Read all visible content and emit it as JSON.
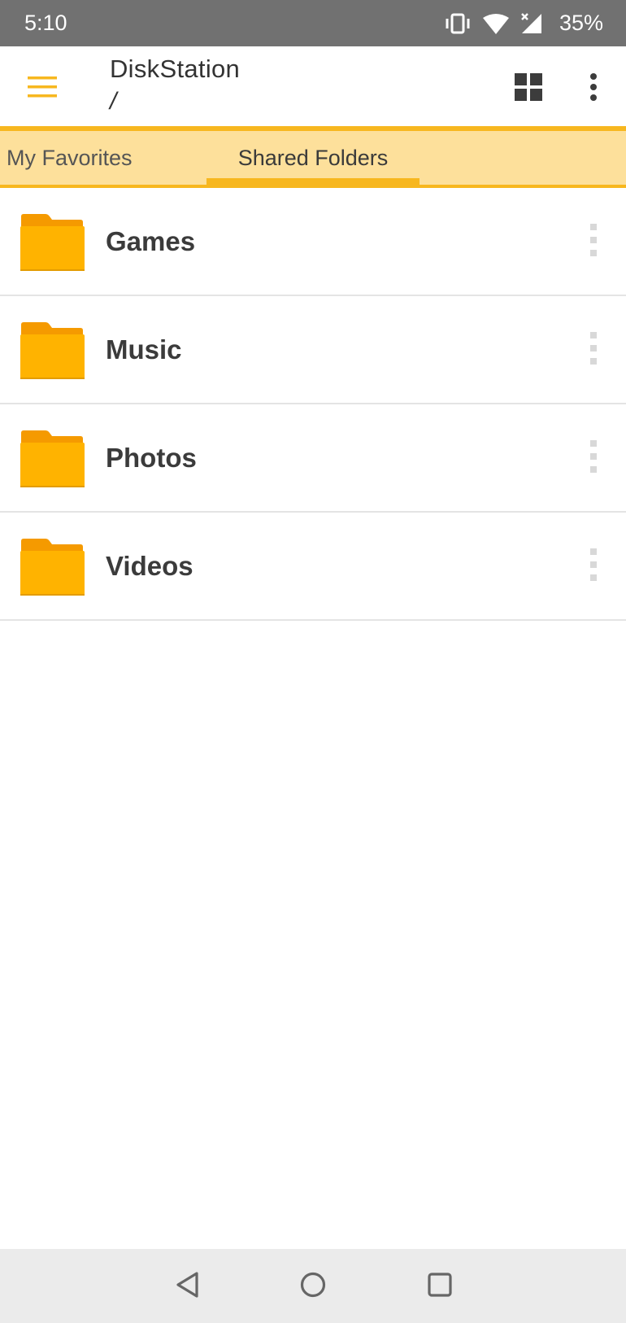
{
  "status_bar": {
    "time": "5:10",
    "battery": "35%",
    "icons": [
      "vibrate-icon",
      "wifi-icon",
      "signal-icon"
    ]
  },
  "app_bar": {
    "title": "DiskStation",
    "path": "/",
    "menu_icon": "hamburger-icon",
    "view_icon": "grid-view-icon",
    "overflow_icon": "more-vert-icon"
  },
  "tabs": [
    {
      "label": "My Favorites",
      "selected": false
    },
    {
      "label": "Shared Folders",
      "selected": true
    }
  ],
  "folders": [
    {
      "name": "Games"
    },
    {
      "name": "Music"
    },
    {
      "name": "Photos"
    },
    {
      "name": "Videos"
    }
  ],
  "colors": {
    "accent": "#f7b71f",
    "tab_background": "#fde09b",
    "folder": "#ffb300",
    "status_bar": "#717171"
  },
  "nav_bar": {
    "buttons": [
      "back-icon",
      "home-icon",
      "recents-icon"
    ]
  }
}
